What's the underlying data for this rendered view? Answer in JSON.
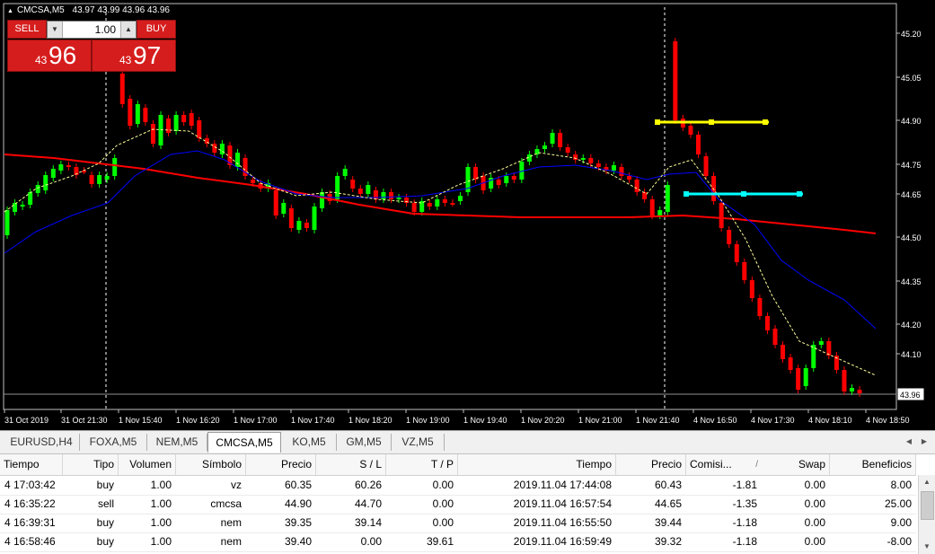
{
  "chart": {
    "symbol_label": "CMCSA,M5",
    "ohlc_label": "43.97 43.99 43.96 43.96",
    "price_axis": [
      "45.20",
      "45.05",
      "44.90",
      "44.75",
      "44.65",
      "44.50",
      "44.35",
      "44.20",
      "44.10"
    ],
    "current_price": "43.96",
    "time_axis": [
      "31 Oct 2019",
      "31 Oct 21:30",
      "1 Nov 15:40",
      "1 Nov 16:20",
      "1 Nov 17:00",
      "1 Nov 17:40",
      "1 Nov 18:20",
      "1 Nov 19:00",
      "1 Nov 19:40",
      "1 Nov 20:20",
      "1 Nov 21:00",
      "1 Nov 21:40",
      "4 Nov 16:50",
      "4 Nov 17:30",
      "4 Nov 18:10",
      "4 Nov 18:50"
    ],
    "colors": {
      "bull": "#00ff00",
      "bear": "#ff0000",
      "ma_slow": "#ff0000",
      "ma_mid": "#0000ff",
      "ma_fast": "#ffff99",
      "line_yellow": "#ffff00",
      "line_cyan": "#00ffff"
    }
  },
  "trade_panel": {
    "sell_label": "SELL",
    "buy_label": "BUY",
    "volume": "1.00",
    "sell_price_small": "43",
    "sell_price_big": "96",
    "buy_price_small": "43",
    "buy_price_big": "97"
  },
  "tabs": [
    {
      "label": "EURUSD,H4",
      "active": false
    },
    {
      "label": "FOXA,M5",
      "active": false
    },
    {
      "label": "NEM,M5",
      "active": false
    },
    {
      "label": "CMCSA,M5",
      "active": true
    },
    {
      "label": "KO,M5",
      "active": false
    },
    {
      "label": "GM,M5",
      "active": false
    },
    {
      "label": "VZ,M5",
      "active": false
    }
  ],
  "table": {
    "headers": [
      "Tiempo",
      "Tipo",
      "Volumen",
      "Símbolo",
      "Precio",
      "S / L",
      "T / P",
      "Tiempo",
      "Precio",
      "Comisi...",
      "/",
      "Swap",
      "Beneficios"
    ],
    "rows": [
      [
        "4 17:03:42",
        "buy",
        "1.00",
        "vz",
        "60.35",
        "60.26",
        "0.00",
        "2019.11.04 17:44:08",
        "60.43",
        "-1.81",
        "0.00",
        "8.00"
      ],
      [
        "4 16:35:22",
        "sell",
        "1.00",
        "cmcsa",
        "44.90",
        "44.70",
        "0.00",
        "2019.11.04 16:57:54",
        "44.65",
        "-1.35",
        "0.00",
        "25.00"
      ],
      [
        "4 16:39:31",
        "buy",
        "1.00",
        "nem",
        "39.35",
        "39.14",
        "0.00",
        "2019.11.04 16:55:50",
        "39.44",
        "-1.18",
        "0.00",
        "9.00"
      ],
      [
        "4 16:58:46",
        "buy",
        "1.00",
        "nem",
        "39.40",
        "0.00",
        "39.61",
        "2019.11.04 16:59:49",
        "39.32",
        "-1.18",
        "0.00",
        "-8.00"
      ]
    ]
  }
}
